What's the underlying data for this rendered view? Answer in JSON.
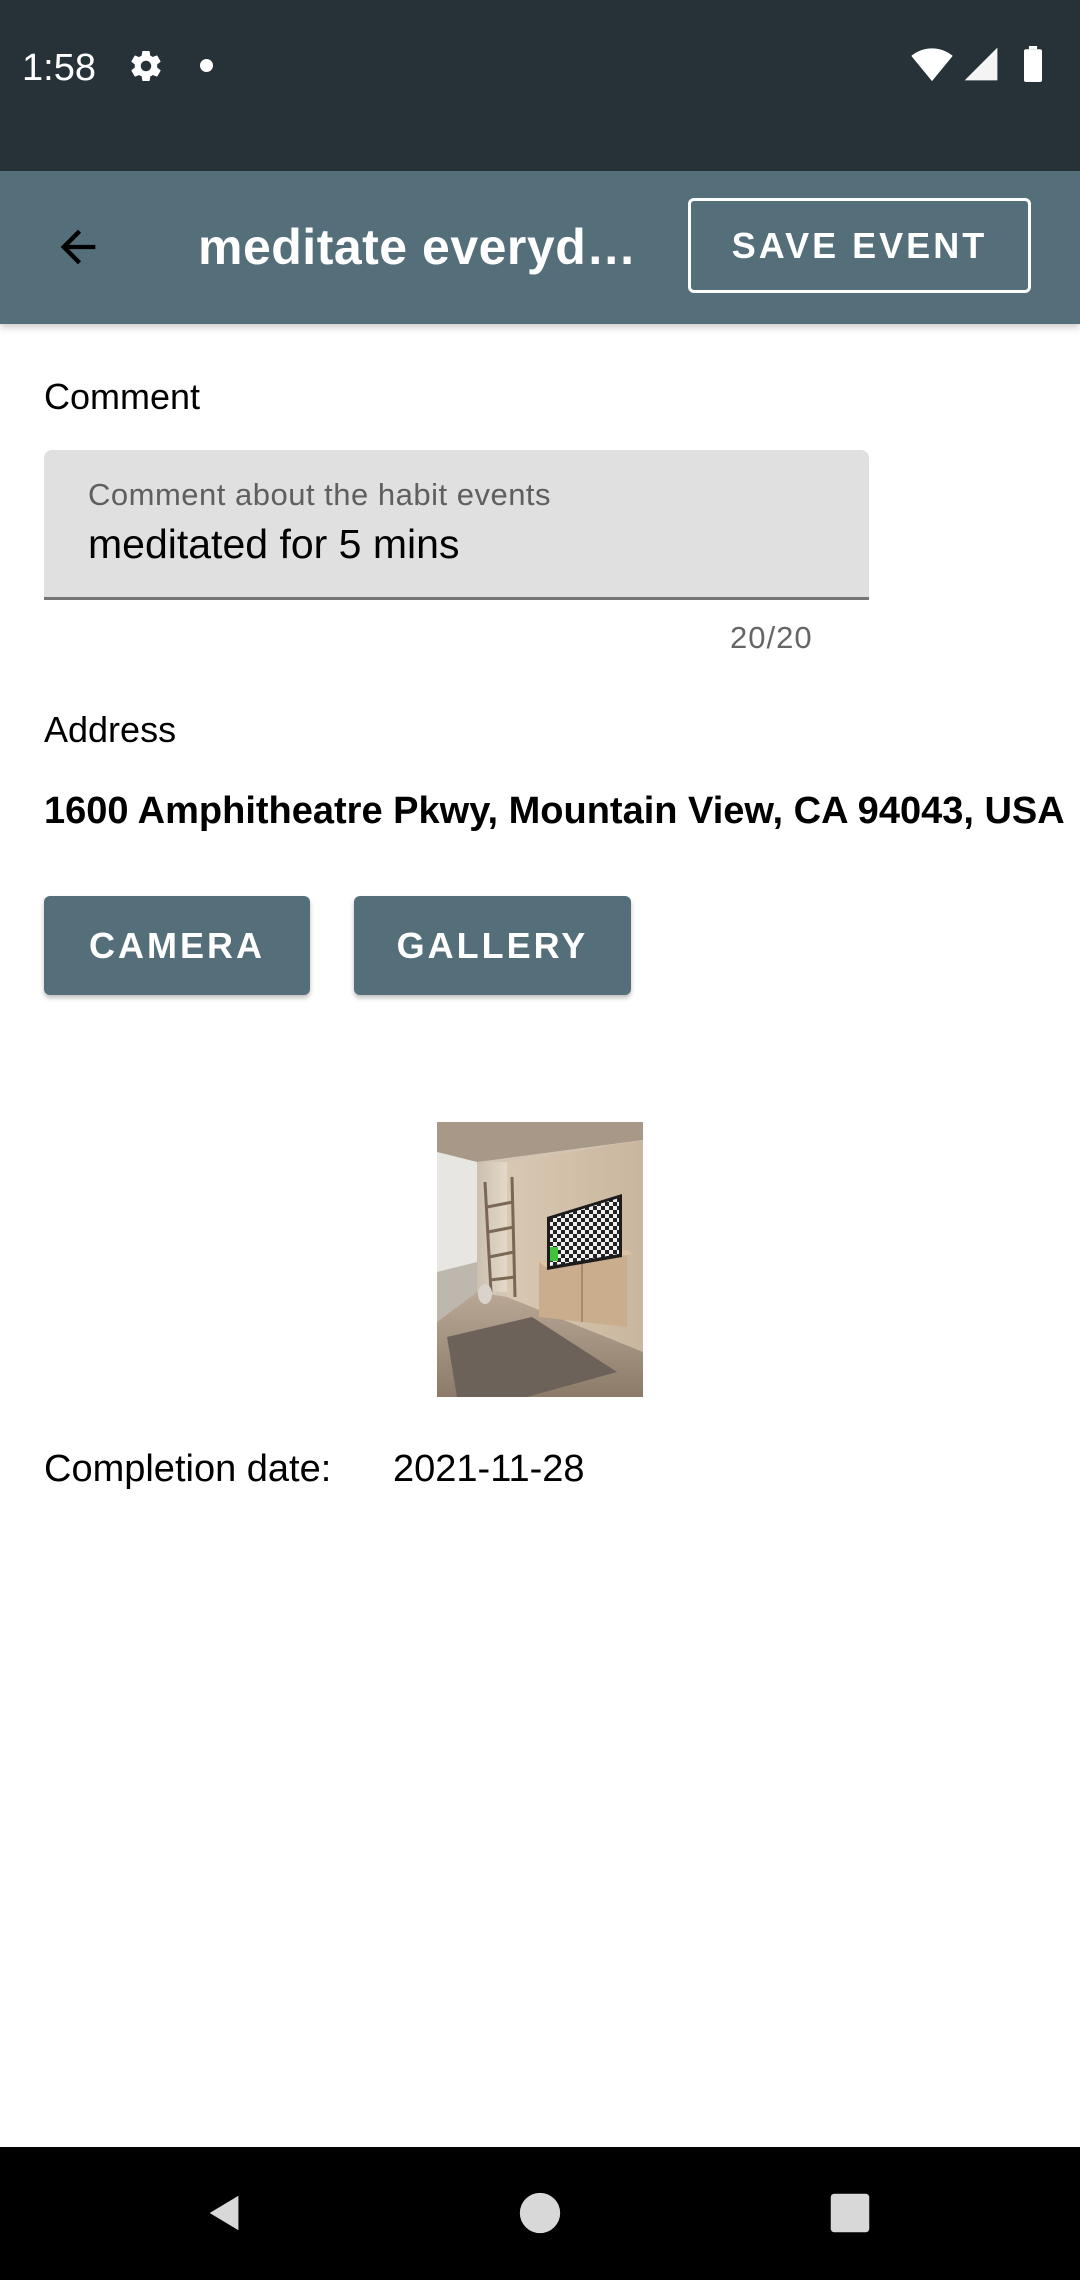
{
  "status_bar": {
    "time": "1:58",
    "icons": [
      "settings-gear-icon",
      "notification-dot-icon",
      "wifi-icon",
      "cell-signal-icon",
      "battery-icon"
    ]
  },
  "app_bar": {
    "back_icon": "arrow-back-icon",
    "title": "meditate everyd…",
    "save_label": "SAVE EVENT",
    "color": "#546e7a"
  },
  "comment": {
    "label": "Comment",
    "hint": "Comment about the habit events",
    "value": "meditated for 5 mins",
    "counter": "20/20"
  },
  "address": {
    "label": "Address",
    "value": "1600 Amphitheatre Pkwy, Mountain View, CA 94043, USA"
  },
  "buttons": {
    "camera": "CAMERA",
    "gallery": "GALLERY"
  },
  "photo": {
    "description_icon": "photo-thumbnail"
  },
  "completion": {
    "label": "Completion date:",
    "value": "2021-11-28"
  },
  "nav_bar": {
    "icons": [
      "nav-back-icon",
      "nav-home-icon",
      "nav-recents-icon"
    ]
  },
  "colors": {
    "status_bar": "#263238",
    "primary": "#546e7a",
    "field_bg": "#e0e0e0"
  }
}
